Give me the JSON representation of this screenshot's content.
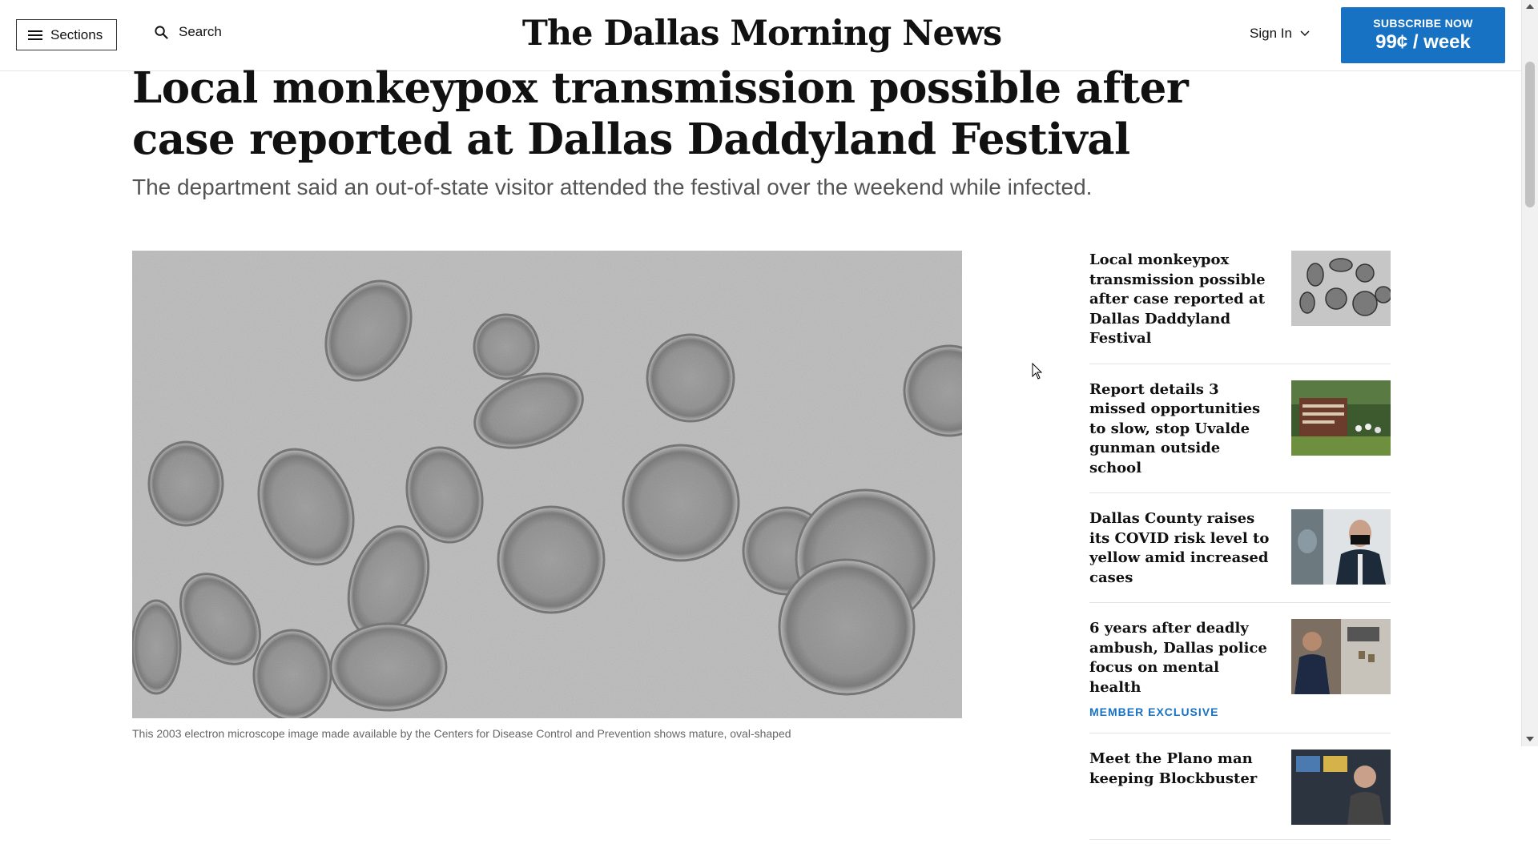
{
  "header": {
    "sections_label": "Sections",
    "search_label": "Search",
    "logo_text": "The Dallas Morning News",
    "signin_label": "Sign In",
    "subscribe_line1": "SUBSCRIBE NOW",
    "subscribe_line2": "99¢ / week",
    "accent_color": "#1872c4"
  },
  "article": {
    "headline": "Local monkeypox transmission possible after case reported at Dallas Daddyland Festival",
    "dek": "The department said an out-of-state visitor attended the festival over the weekend while infected.",
    "caption": "This 2003 electron microscope image made available by the Centers for Disease Control and Prevention shows mature, oval-shaped"
  },
  "sidebar": {
    "items": [
      {
        "title": "Local monkeypox transmission possible after case reported at Dallas Daddyland Festival",
        "badge": "",
        "thumb": "microscope-image"
      },
      {
        "title": "Report details 3 missed opportunities to slow, stop Uvalde gunman outside school",
        "badge": "",
        "thumb": "school-memorial-image"
      },
      {
        "title": "Dallas County raises its COVID risk level to yellow amid increased cases",
        "badge": "",
        "thumb": "officials-masks-image"
      },
      {
        "title": "6 years after deadly ambush, Dallas police focus on mental health",
        "badge": "MEMBER EXCLUSIVE",
        "thumb": "police-chief-image"
      },
      {
        "title": "Meet the Plano man keeping Blockbuster",
        "badge": "",
        "thumb": "blockbuster-man-image"
      }
    ]
  }
}
